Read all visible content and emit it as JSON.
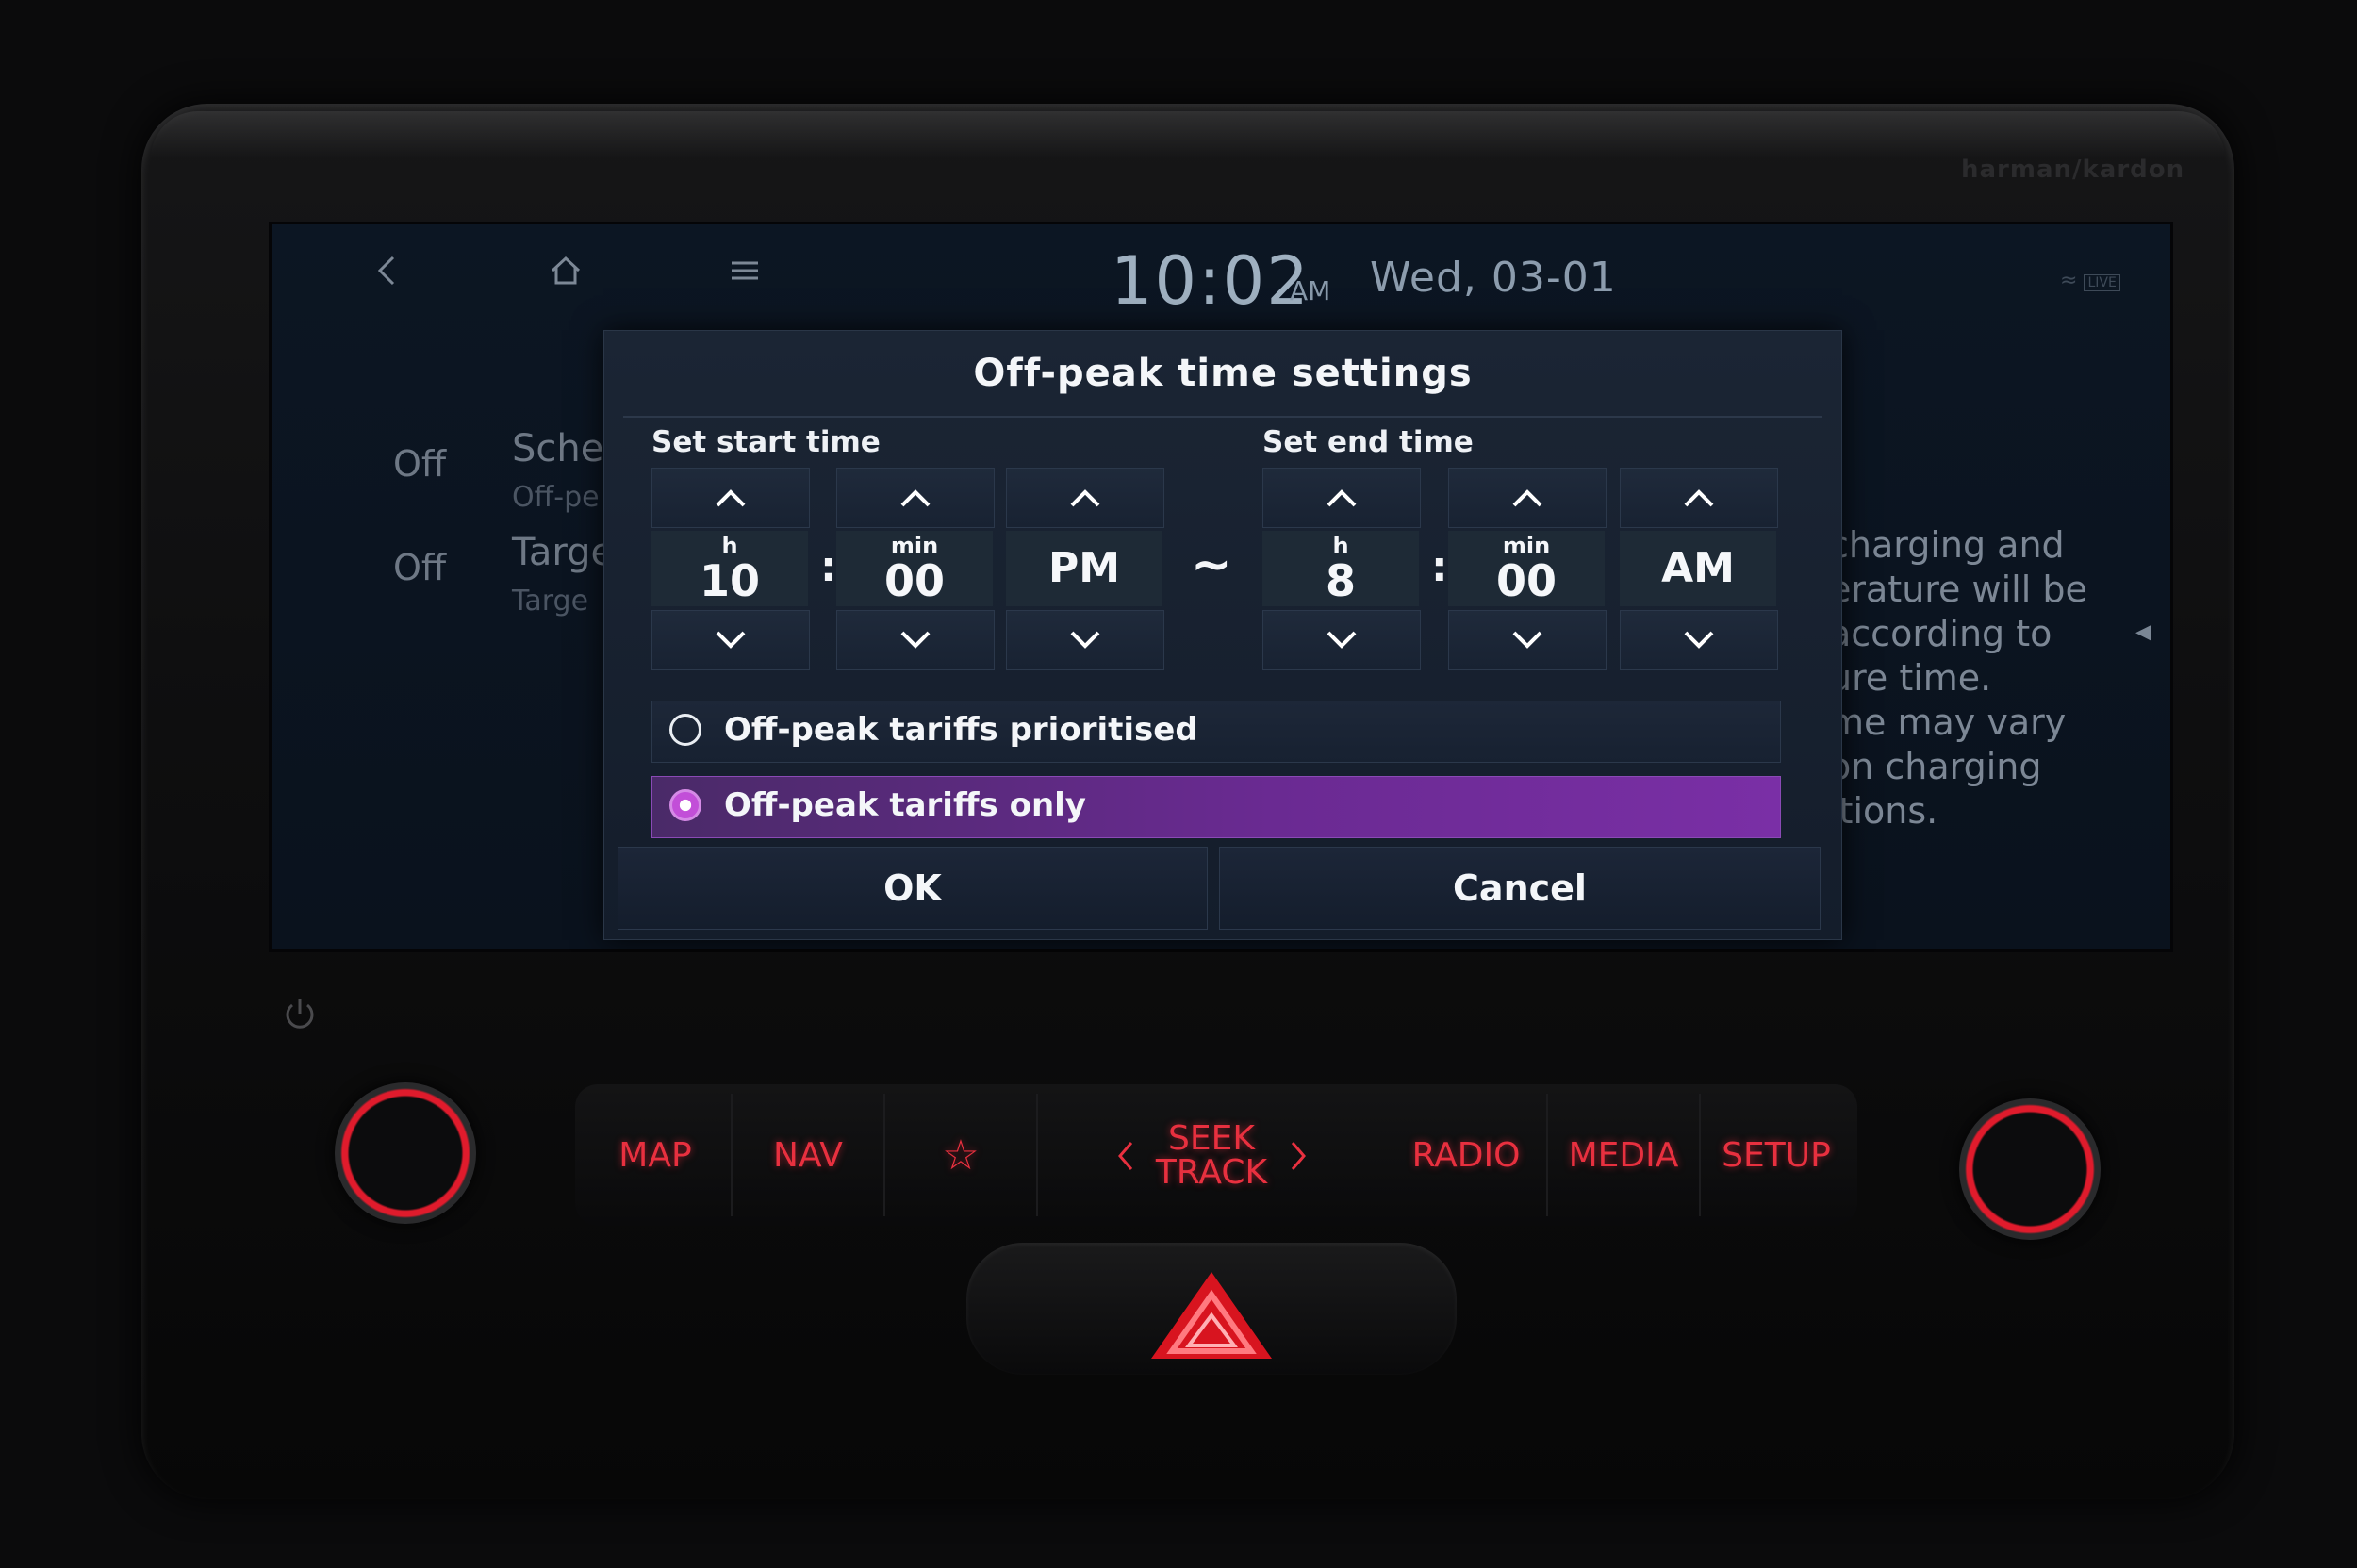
{
  "header": {
    "time": "10:02",
    "ampm": "AM",
    "date": "Wed, 03-01",
    "icons": [
      "back-icon",
      "home-icon",
      "menu-icon"
    ]
  },
  "background": {
    "rows": [
      {
        "toggle": "Off",
        "title": "Sche",
        "subtitle": "Off-pe"
      },
      {
        "toggle": "Off",
        "title": "Targe",
        "subtitle": "Targe"
      }
    ],
    "description": "charging and\nerature will be\naccording to\nure time.\nme may vary\non charging\nitions."
  },
  "dialog": {
    "title": "Off-peak time settings",
    "start_label": "Set start time",
    "end_label": "Set end time",
    "start": {
      "hour_unit": "h",
      "hour": "10",
      "min_unit": "min",
      "minute": "00",
      "ampm": "PM"
    },
    "end": {
      "hour_unit": "h",
      "hour": "8",
      "min_unit": "min",
      "minute": "00",
      "ampm": "AM"
    },
    "separator": ":",
    "range_separator": "~",
    "options": [
      {
        "label": "Off-peak tariffs prioritised",
        "selected": false
      },
      {
        "label": "Off-peak tariffs only",
        "selected": true
      }
    ],
    "ok_label": "OK",
    "cancel_label": "Cancel"
  },
  "hardware": {
    "brand": "harman/kardon",
    "buttons": {
      "map": "MAP",
      "nav": "NAV",
      "favorite": "☆",
      "seek": "SEEK",
      "track": "TRACK",
      "radio": "RADIO",
      "media": "MEDIA",
      "setup": "SETUP"
    },
    "status_icons": "LIVE"
  },
  "colors": {
    "accent_purple": "#6a2a92",
    "hardware_red": "#e8303f",
    "screen_bg": "#0c1623"
  }
}
